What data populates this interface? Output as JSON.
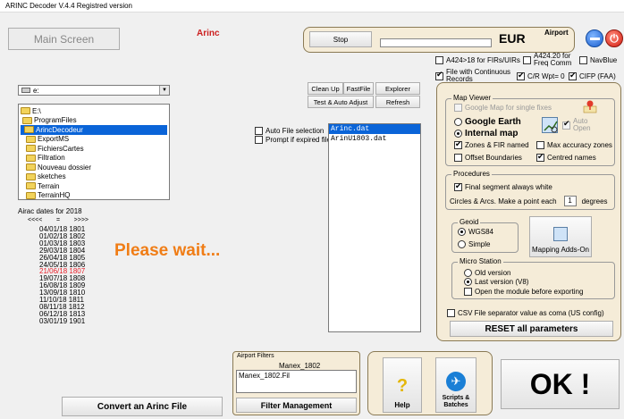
{
  "window": {
    "title": "ARINC Decoder V.4.4  Registred version"
  },
  "header": {
    "main_screen": "Main Screen",
    "arinc_label": "Arinc",
    "stop": "Stop",
    "region": "EUR",
    "airport": "Airport"
  },
  "options_top": {
    "a424_firs": "A424>18 for FIRs/UIRs",
    "a424_freq": "A424.20 for Freq Comm",
    "navblue": "NavBlue",
    "continuous": "File with Continuous Records",
    "cr_wpt": "C/R Wpt= 0",
    "cifp": "CIFP (FAA)"
  },
  "drive": {
    "value": "e:"
  },
  "folders": [
    "E:\\",
    "ProgramFiles",
    "ArincDecodeur",
    "ExportMS",
    "FichiersCartes",
    "Filtration",
    "Nouveau dossier",
    "sketches",
    "Terrain",
    "TerrainHQ"
  ],
  "airac": {
    "heading": "Airac dates for 2018",
    "nav_prev": "<<<<",
    "nav_eq": "=",
    "nav_next": ">>>>",
    "dates": [
      "04/01/18 1801",
      "01/02/18 1802",
      "01/03/18 1803",
      "29/03/18 1804",
      "26/04/18 1805",
      "24/05/18 1806",
      "21/06/18 1807",
      "19/07/18 1808",
      "16/08/18 1809",
      "13/09/18 1810",
      "11/10/18 1811",
      "08/11/18 1812",
      "06/12/18 1813",
      "03/01/19 1901"
    ],
    "highlight_color": "#e8202a"
  },
  "status": {
    "please_wait": "Please wait..."
  },
  "file_buttons": {
    "clean_up": "Clean Up",
    "fast_file": "FastFile",
    "explorer": "Explorer",
    "test_adjust": "Test & Auto Adjust",
    "refresh": "Refresh"
  },
  "file_options": {
    "auto_select": "Auto File selection",
    "prompt_expired": "Prompt if expired file"
  },
  "files": [
    "Arinc.dat",
    "ArinU1803.dat"
  ],
  "map_viewer": {
    "legend": "Map Viewer",
    "google_single": "Google Map for single fixes",
    "google_earth": "Google Earth",
    "internal_map": "Internal map",
    "auto_open": "Auto Open",
    "zones": "Zones & FIR named",
    "max_accuracy": "Max accuracy zones",
    "offset": "Offset Boundaries",
    "centred": "Centred names"
  },
  "procedures": {
    "legend": "Procedures",
    "final_segment": "Final segment always white",
    "circles_label": "Circles & Arcs. Make a point each",
    "degrees_value": "1",
    "degrees": "degrees"
  },
  "geoid": {
    "legend": "Geoid",
    "wgs84": "WGS84",
    "simple": "Simple"
  },
  "mapping_addons": "Mapping Adds-On",
  "micro_station": {
    "legend": "Micro Station",
    "old": "Old version",
    "last": "Last version (V8)",
    "open_module": "Open the module before exporting"
  },
  "csv": "CSV File separator value as coma (US config)",
  "reset": "RESET all parameters",
  "airport_filters": {
    "legend": "Airport Filters",
    "name": "Manex_1802",
    "list": [
      "Manex_1802.Fil"
    ],
    "button": "Filter Management"
  },
  "bottom": {
    "convert": "Convert an Arinc File",
    "help": "Help",
    "help_icon": "?",
    "scripts": "Scripts & Batches",
    "ok": "OK !"
  },
  "colors": {
    "accent_orange": "#f07d16",
    "arinc_red": "#cc1f1f",
    "selection_blue": "#0a64d8"
  }
}
